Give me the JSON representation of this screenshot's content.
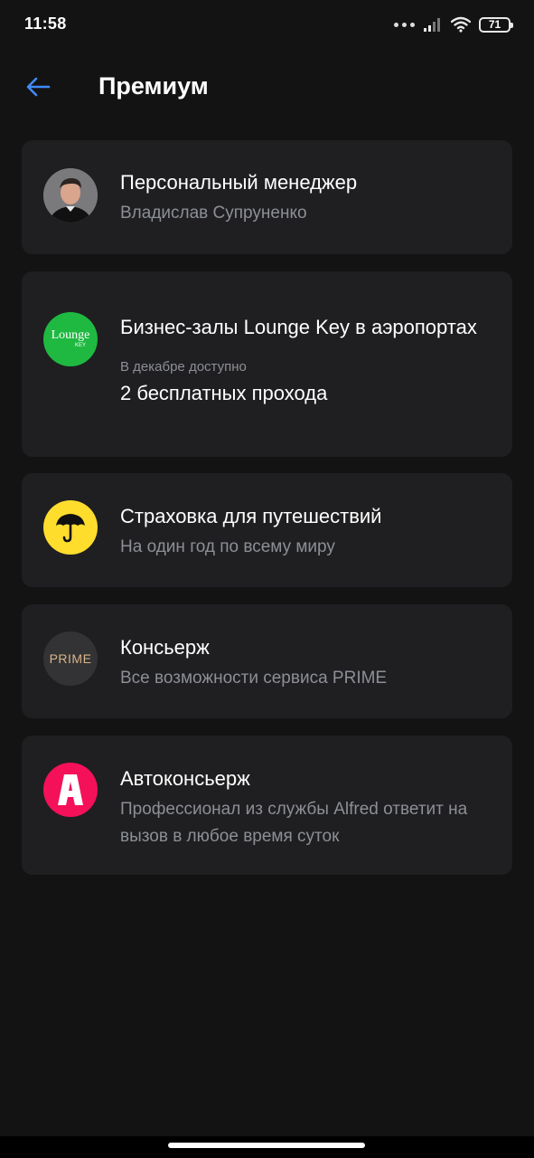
{
  "status_bar": {
    "time": "11:58",
    "battery": "71"
  },
  "header": {
    "title": "Премиум"
  },
  "cards": [
    {
      "id": "manager",
      "title": "Персональный менеджер",
      "subtitle": "Владислав Супруненко",
      "icon": "avatar"
    },
    {
      "id": "lounge",
      "title": "Бизнес-залы Lounge Key в аэропортах",
      "small_label": "В декабре доступно",
      "value": "2 бесплатных прохода",
      "icon": "lounge-key-logo",
      "logo_text": "Lounge",
      "logo_subtext": "KEY",
      "color": "#1fb941"
    },
    {
      "id": "insurance",
      "title": "Страховка для путешествий",
      "subtitle": "На один год по всему миру",
      "icon": "umbrella-icon",
      "color": "#ffdd2d"
    },
    {
      "id": "concierge",
      "title": "Консьерж",
      "subtitle": "Все возможности сервиса PRIME",
      "icon": "prime-logo",
      "logo_text": "PRIME",
      "color": "#333335"
    },
    {
      "id": "autoconcierge",
      "title": "Автоконсьерж",
      "subtitle": "Профессионал из службы Alfred ответит на вызов в любое время суток",
      "icon": "alfred-logo",
      "color": "#f5105a"
    }
  ],
  "colors": {
    "background": "#131314",
    "card": "#1f1f21",
    "accent": "#428bf9",
    "secondary_text": "#8c8f96"
  }
}
